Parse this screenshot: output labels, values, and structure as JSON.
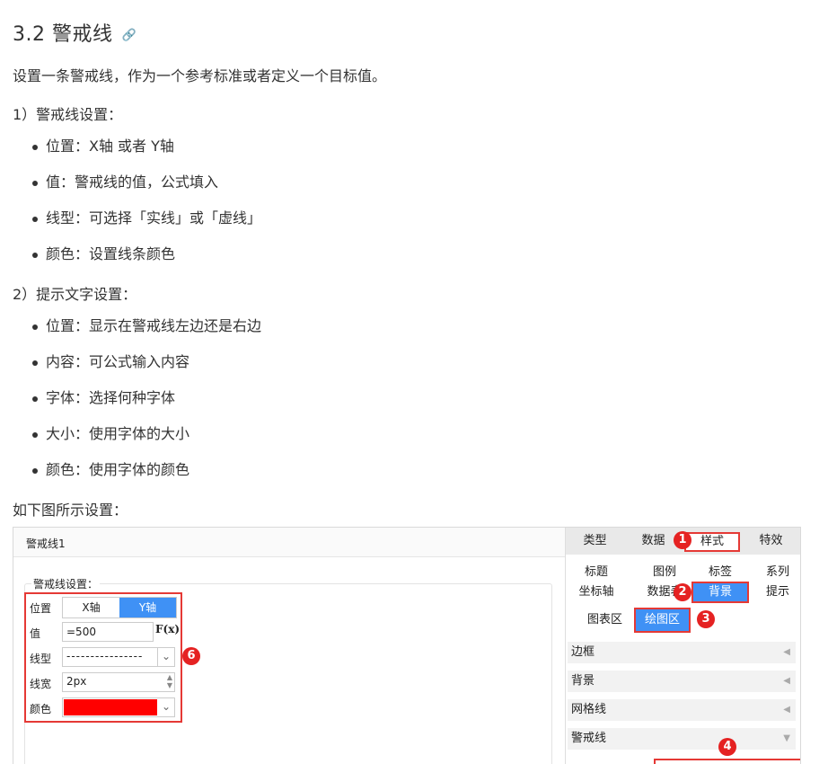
{
  "heading": {
    "title": "3.2 警戒线",
    "anchor_icon": "link-icon"
  },
  "intro": "设置一条警戒线，作为一个参考标准或者定义一个目标值。",
  "section1": {
    "title": "1）警戒线设置：",
    "items": [
      "位置：X轴 或者 Y轴",
      "值：警戒线的值，公式填入",
      "线型：可选择「实线」或「虚线」",
      "颜色：设置线条颜色"
    ]
  },
  "section2": {
    "title": "2）提示文字设置：",
    "items": [
      "位置：显示在警戒线左边还是右边",
      "内容：可公式输入内容",
      "字体：选择何种字体",
      "大小：使用字体的大小",
      "颜色：使用字体的颜色"
    ]
  },
  "figure_caption": "如下图所示设置：",
  "screenshot": {
    "window_title": "警戒线1",
    "box_title": "警戒线设置：",
    "form": {
      "position_label": "位置",
      "x_axis": "X轴",
      "y_axis": "Y轴",
      "value_label": "值",
      "value": "=500",
      "fx": "F(x)",
      "linetype_label": "线型",
      "linetype_value": "----------------",
      "linewidth_label": "线宽",
      "linewidth_value": "2px",
      "color_label": "颜色",
      "color_value": "#ff0000"
    },
    "tabs": [
      "类型",
      "数据",
      "样式",
      "特效"
    ],
    "subtabs": [
      "标题",
      "图例",
      "标签",
      "系列",
      "坐标轴",
      "数据表",
      "背景",
      "提示"
    ],
    "chips": [
      "图表区",
      "绘图区"
    ],
    "sections": [
      "边框",
      "背景",
      "网格线",
      "警戒线"
    ],
    "badges": [
      "1",
      "2",
      "3",
      "4",
      "6"
    ]
  }
}
